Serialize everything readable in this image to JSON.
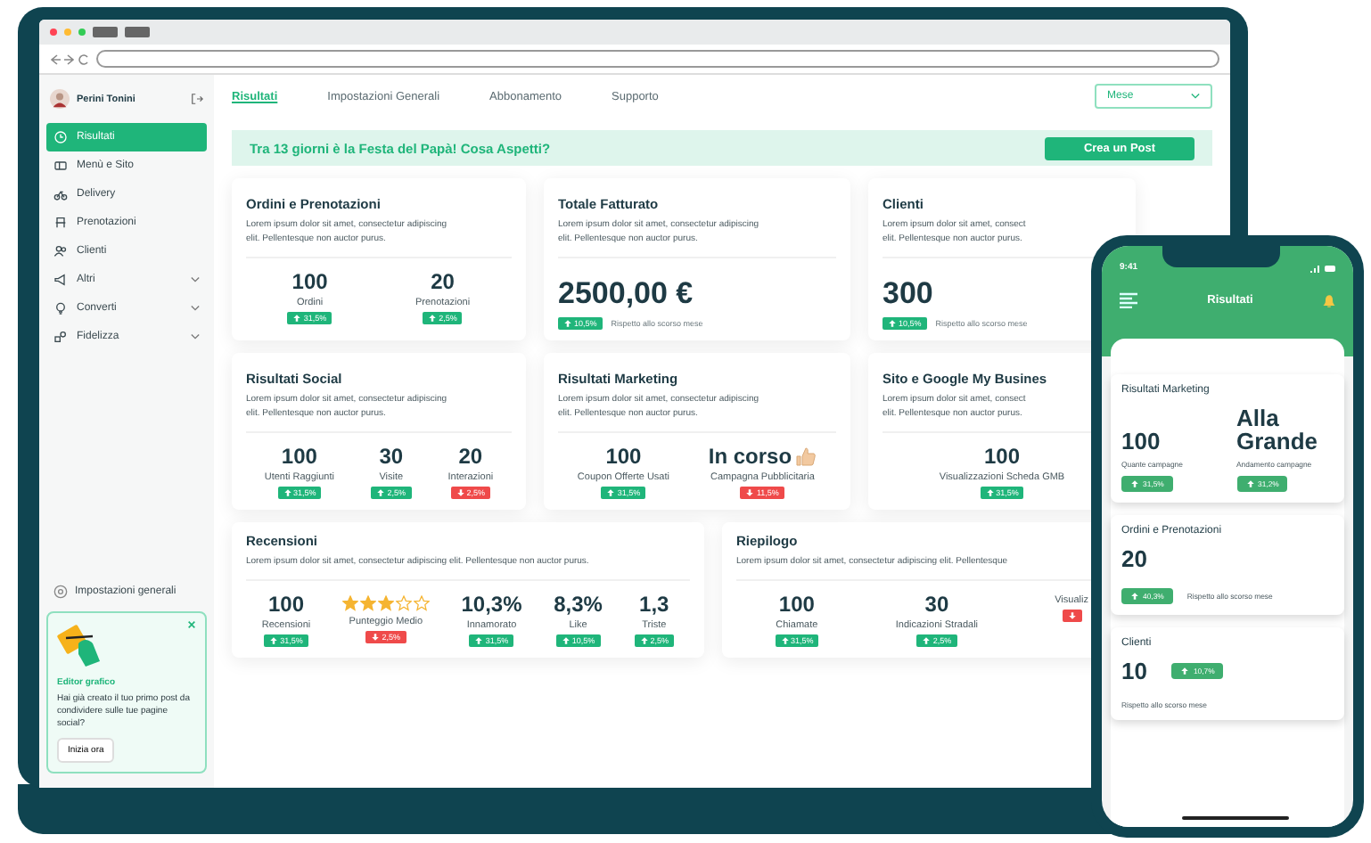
{
  "user": {
    "name": "Perini Tonini"
  },
  "sidebar": {
    "items": [
      {
        "label": "Risultati",
        "kind": "link",
        "selected": true
      },
      {
        "label": "Menù e Sito",
        "kind": "link",
        "selected": false
      },
      {
        "label": "Delivery",
        "kind": "link",
        "selected": false
      },
      {
        "label": "Prenotazioni",
        "kind": "link",
        "selected": false
      },
      {
        "label": "Clienti",
        "kind": "link",
        "selected": false
      },
      {
        "label": "Altri",
        "kind": "group",
        "selected": false
      },
      {
        "label": "Converti",
        "kind": "group",
        "selected": false
      },
      {
        "label": "Fidelizza",
        "kind": "group",
        "selected": false
      }
    ],
    "settings": "Impostazioni generali",
    "promo": {
      "title": "Editor grafico",
      "text": "Hai già creato il tuo primo post da condividere sulle tue pagine social?",
      "button": "Inizia ora"
    }
  },
  "tabs": [
    {
      "label": "Risultati",
      "selected": true
    },
    {
      "label": "Impostazioni Generali",
      "selected": false
    },
    {
      "label": "Abbonamento",
      "selected": false
    },
    {
      "label": "Supporto",
      "selected": false
    }
  ],
  "period": {
    "value": "Mese"
  },
  "banner": {
    "text": "Tra 13 giorni è la Festa del Papà! Cosa Aspetti?",
    "button": "Crea un Post"
  },
  "rows": [
    [
      {
        "title": "Ordini e Prenotazioni",
        "lines": [
          "Lorem ipsum dolor sit amet, consectetur adipiscing",
          "elit. Pellentesque non auctor purus."
        ],
        "kind": "stats",
        "stats": [
          {
            "value": "100",
            "label": "Ordini",
            "badge": {
              "text": "31,5%",
              "down": false
            }
          },
          {
            "value": "20",
            "label": "Prenotazioni",
            "badge": {
              "text": "2,5%",
              "down": false
            }
          }
        ]
      },
      {
        "title": "Totale Fatturato",
        "lines": [
          "Lorem ipsum dolor sit amet, consectetur adipiscing",
          "elit. Pellentesque non auctor purus."
        ],
        "kind": "total",
        "value": "2500,00 €",
        "badge": {
          "text": "10,5%",
          "down": false
        },
        "note": "Rispetto allo scorso mese"
      },
      {
        "title": "Clienti",
        "lines": [
          "Lorem ipsum dolor sit amet, consect",
          "elit. Pellentesque non auctor purus."
        ],
        "kind": "total",
        "value": "300",
        "badge": {
          "text": "10,5%",
          "down": false
        },
        "note": "Rispetto allo scorso mese"
      }
    ],
    [
      {
        "title": "Risultati Social",
        "lines": [
          "Lorem ipsum dolor sit amet, consectetur adipiscing",
          "elit. Pellentesque non auctor purus."
        ],
        "kind": "stats",
        "stats": [
          {
            "value": "100",
            "label": "Utenti Raggiunti",
            "badge": {
              "text": "31,5%",
              "down": false
            }
          },
          {
            "value": "30",
            "label": "Visite",
            "badge": {
              "text": "2,5%",
              "down": false
            }
          },
          {
            "value": "20",
            "label": "Interazioni",
            "badge": {
              "text": "2,5%",
              "down": true
            }
          }
        ]
      },
      {
        "title": "Risultati Marketing",
        "lines": [
          "Lorem ipsum dolor sit amet, consectetur adipiscing",
          "elit. Pellentesque non auctor purus."
        ],
        "kind": "stats",
        "stats": [
          {
            "value": "100",
            "label": "Coupon Offerte Usati",
            "badge": {
              "text": "31,5%",
              "down": false
            }
          },
          {
            "value": "In corso",
            "label": "Campagna Pubblicitaria",
            "thumb": true,
            "badge": {
              "text": "11,5%",
              "down": true
            }
          }
        ]
      },
      {
        "title": "Sito e Google My Busines",
        "lines": [
          "Lorem ipsum dolor sit amet, consect",
          "elit. Pellentesque non auctor purus."
        ],
        "kind": "stats",
        "stats": [
          {
            "value": "100",
            "label": "Visualizzazioni Scheda GMB",
            "badge": {
              "text": "31,5%",
              "down": false
            }
          }
        ]
      }
    ],
    [
      {
        "title": "Recensioni",
        "lines": [
          "Lorem ipsum dolor sit amet, consectetur adipiscing elit. Pellentesque non auctor purus."
        ],
        "kind": "stats",
        "stats": [
          {
            "value": "100",
            "label": "Recensioni",
            "badge": {
              "text": "31,5%",
              "down": false
            }
          },
          {
            "stars": 3,
            "label": "Punteggio Medio",
            "badge": {
              "text": "2,5%",
              "down": true
            }
          },
          {
            "value": "10,3%",
            "label": "Innamorato",
            "badge": {
              "text": "31,5%",
              "down": false
            }
          },
          {
            "value": "8,3%",
            "label": "Like",
            "badge": {
              "text": "10,5%",
              "down": false
            }
          },
          {
            "value": "1,3",
            "label": "Triste",
            "badge": {
              "text": "2,5%",
              "down": false
            }
          }
        ]
      },
      {
        "title": "Riepilogo",
        "lines": [
          "Lorem ipsum dolor sit amet, consectetur adipiscing elit. Pellentesque"
        ],
        "kind": "stats",
        "stats": [
          {
            "value": "100",
            "label": "Chiamate",
            "badge": {
              "text": "31,5%",
              "down": false
            }
          },
          {
            "value": "30",
            "label": "Indicazioni Stradali",
            "badge": {
              "text": "2,5%",
              "down": false
            }
          },
          {
            "label": "Visualiz",
            "badge": {
              "down": true
            }
          }
        ]
      }
    ]
  ],
  "phone": {
    "time": "9:41",
    "title": "Risultati",
    "cards": [
      {
        "title": "Risultati Marketing",
        "kind": "stats",
        "stats": [
          {
            "value": "100",
            "label": "Quante campagne",
            "badge": {
              "text": "31,5%",
              "down": false
            }
          },
          {
            "value": "Alla Grande",
            "label": "Andamento campagne",
            "badge": {
              "text": "31,2%",
              "down": false
            }
          }
        ]
      },
      {
        "title": "Ordini e Prenotazioni",
        "kind": "note",
        "value": "20",
        "badge": {
          "text": "40,3%",
          "down": false
        },
        "note": "Rispetto allo scorso mese"
      },
      {
        "title": "Clienti",
        "kind": "side",
        "value": "10",
        "badge": {
          "text": "10,7%",
          "down": false
        },
        "note": "Rispetto allo scorso mese"
      }
    ]
  }
}
